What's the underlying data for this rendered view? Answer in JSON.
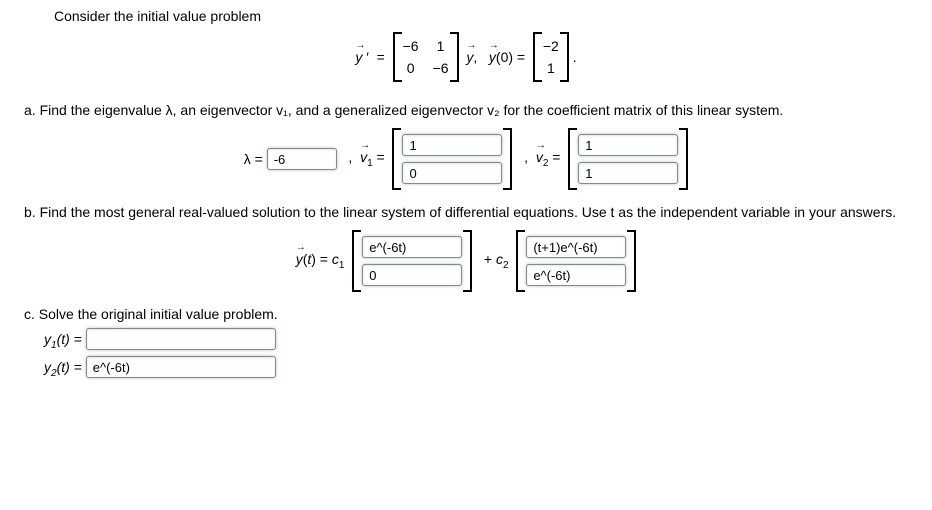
{
  "intro": "Consider the initial value problem",
  "equation": {
    "lhs": "y′",
    "matrixA": {
      "r1c1": "−6",
      "r1c2": "1",
      "r2c1": "0",
      "r2c2": "−6"
    },
    "mid": "y,   y(0) =",
    "vec0": {
      "r1": "−2",
      "r2": "1"
    }
  },
  "partA": {
    "text": "a. Find the eigenvalue λ, an eigenvector v₁, and a generalized eigenvector v₂ for the coefficient matrix of this linear system.",
    "lambda_label": "λ =",
    "lambda_value": "-6",
    "v1_label": ", v₁ =",
    "v1": {
      "r1": "1",
      "r2": "0"
    },
    "v2_label": ", v₂ =",
    "v2": {
      "r1": "1",
      "r2": "1"
    }
  },
  "partB": {
    "text": "b. Find the most general real-valued solution to the linear system of differential equations. Use t as the independent variable in your answers.",
    "ylabel": "y(t) = c₁",
    "col1": {
      "r1": "e^(-6t)",
      "r2": "0"
    },
    "plus": "+ c₂",
    "col2": {
      "r1": "(t+1)e^(-6t)",
      "r2": "e^(-6t)"
    }
  },
  "partC": {
    "text": "c. Solve the original initial value problem.",
    "y1label": "y₁(t) =",
    "y1value": "",
    "y2label": "y₂(t) =",
    "y2value": "e^(-6t)"
  }
}
